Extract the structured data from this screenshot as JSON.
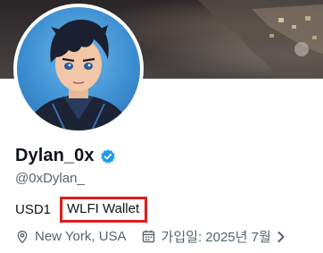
{
  "profile": {
    "display_name": "Dylan_0x",
    "handle": "@0xDylan_",
    "verified": true,
    "bio_prefix": "USD1",
    "bio_highlight": "WLFI Wallet",
    "location": "New York, USA",
    "joined": "가입일: 2025년 7월"
  },
  "icons": {
    "verified": "verified-badge-icon",
    "location": "location-pin-icon",
    "calendar": "calendar-icon",
    "chevron": "chevron-right-icon"
  },
  "colors": {
    "verified_blue": "#1d9bf0",
    "highlight_border": "#e31b1b",
    "muted_text": "#536471"
  }
}
